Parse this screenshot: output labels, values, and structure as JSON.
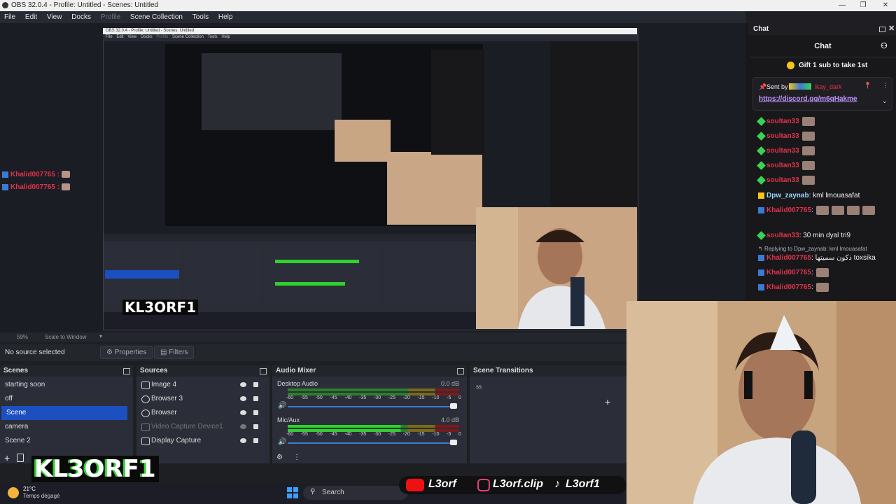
{
  "window": {
    "title": "OBS 32.0.4 - Profile: Untitled - Scenes: Untitled"
  },
  "nested_window": {
    "title": "OBS 32.0.4 - Profile: Untitled - Scenes: Untitled",
    "menu": [
      "File",
      "Edit",
      "View",
      "Docks",
      "Profile",
      "Scene Collection",
      "Tools",
      "Help"
    ]
  },
  "menu": {
    "items": [
      "File",
      "Edit",
      "View",
      "Docks",
      "Profile",
      "Scene Collection",
      "Tools",
      "Help"
    ]
  },
  "overlay_chat": [
    {
      "name": "Khalid007765",
      "sep": ":"
    },
    {
      "name": "Khalid007765",
      "sep": ":"
    }
  ],
  "preview": {
    "zoom": "59%",
    "scale_mode": "Scale to Window"
  },
  "source_bar": {
    "status": "No source selected",
    "properties": "Properties",
    "filters": "Filters"
  },
  "scenes": {
    "title": "Scenes",
    "items": [
      "starting soon",
      "off",
      "Scene",
      "camera",
      "Scene 2"
    ],
    "selected": 2
  },
  "sources": {
    "title": "Sources",
    "items": [
      {
        "label": "Image 4",
        "disabled": false
      },
      {
        "label": "Browser 3",
        "disabled": false
      },
      {
        "label": "Browser",
        "disabled": false
      },
      {
        "label": "Video Capture Device1",
        "disabled": true
      },
      {
        "label": "Display Capture",
        "disabled": false
      }
    ]
  },
  "audio_mixer": {
    "title": "Audio Mixer",
    "channels": [
      {
        "name": "Desktop Audio",
        "db": "0.0 dB"
      },
      {
        "name": "Mic/Aux",
        "db": "4.0 dB"
      }
    ],
    "ticks": [
      "-60",
      "-55",
      "-50",
      "-45",
      "-40",
      "-35",
      "-30",
      "-25",
      "-20",
      "-15",
      "-10",
      "-5",
      "0"
    ]
  },
  "scene_transitions": {
    "title": "Scene Transitions",
    "value": "ss"
  },
  "brand": {
    "logo_text": "KL3ORF1",
    "social": [
      "L3orf",
      "L3orf.clip",
      "L3orf1"
    ]
  },
  "taskbar": {
    "weather": "21°C",
    "weather_desc": "Temps dégagé",
    "search": "Search"
  },
  "chat": {
    "dock_title": "Chat",
    "header": "Chat",
    "gift": "Gift 1 sub to take 1st",
    "pinned_label": "Sent by",
    "pinned_user": "lkay_dark",
    "pinned_link": "https://discord.gg/m6qHakme",
    "messages": [
      {
        "name": "soultan33",
        "text": "",
        "badge_color": "#39d353",
        "emote": true
      },
      {
        "name": "soultan33",
        "text": "",
        "badge_color": "#39d353",
        "emote": true
      },
      {
        "name": "soultan33",
        "text": "",
        "badge_color": "#39d353",
        "emote": true
      },
      {
        "name": "soultan33",
        "text": "",
        "badge_color": "#39d353",
        "emote": true
      },
      {
        "name": "soultan33",
        "text": "",
        "badge_color": "#39d353",
        "emote": true
      },
      {
        "name": "Dpw_zaynab",
        "text": ": kml lmouasafat",
        "badge_color": "#f5c518",
        "emote": false
      },
      {
        "name": "Khalid007765",
        "text": ":",
        "badge_color": "#3b7bd6",
        "emote": true
      },
      {
        "name": "soultan33",
        "text": ": 30 min dyal tri9",
        "badge_color": "#39d353",
        "emote": false
      },
      {
        "name": "Khalid007765",
        "text": ": ذكون سميتها toxsika",
        "badge_color": "#3b7bd6",
        "emote": false,
        "reply": "Replying to Dpw_zaynab: kml lmouasafat"
      },
      {
        "name": "Khalid007765",
        "text": ":",
        "badge_color": "#3b7bd6",
        "emote": true
      },
      {
        "name": "Khalid007765",
        "text": ":",
        "badge_color": "#3b7bd6",
        "emote": true
      }
    ]
  },
  "colors": {
    "accent": "#1c4fbf",
    "chat_name": "#e0334a",
    "green_meter": "#2fd12f"
  }
}
